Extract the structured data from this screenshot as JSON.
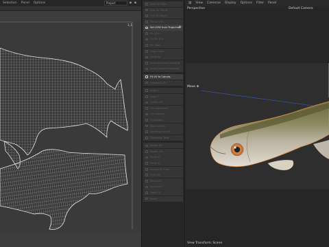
{
  "uv_editor": {
    "menu": [
      "Selection",
      "Panel",
      "Options"
    ],
    "dropdown_value": "Project",
    "corner_mark": "1,1"
  },
  "tools": [
    {
      "label": "Split UV Shell",
      "active": false
    },
    {
      "label": "Sew UV Shells",
      "active": false
    },
    {
      "label": "Cut UV Edges",
      "active": false
    },
    {
      "label": "Planar UVs",
      "active": false
    },
    {
      "label": "Set UVW from Projection",
      "active": true,
      "gear": true
    },
    {
      "label": "Pin UVs",
      "active": false
    },
    {
      "label": "Un-Pin UVs",
      "active": false
    },
    {
      "label": "Pin Shell",
      "active": false
    },
    {
      "label": "Unpin Shell",
      "active": false
    },
    {
      "label": "Un-Wrap",
      "active": false
    },
    {
      "label": "Scale Selected Mapping",
      "active": false
    },
    {
      "label": "Snap Selected Mapping",
      "active": false
    },
    {
      "label": "Fit UV to Canvas",
      "active": true,
      "gap_before": true
    },
    {
      "label": "Unwrap to Fit",
      "active": false
    },
    {
      "label": "Align U",
      "active": false,
      "gap_before": true
    },
    {
      "label": "Align V",
      "active": false
    },
    {
      "label": "Center UV",
      "active": false
    },
    {
      "label": "Flip Horizontal",
      "active": false
    },
    {
      "label": "Flip Vertical",
      "active": false
    },
    {
      "label": "Straighten",
      "active": false
    },
    {
      "label": "Stack Shells",
      "active": false
    },
    {
      "label": "Distribute Shells",
      "active": false
    },
    {
      "label": "Normalize Texel",
      "active": false
    },
    {
      "label": "Rotate 90",
      "active": false,
      "gap_before": true
    },
    {
      "label": "Rotate -90",
      "active": false
    },
    {
      "label": "Mirror U",
      "active": false
    },
    {
      "label": "Mirror V",
      "active": false
    },
    {
      "label": "Layout UV Tiles",
      "active": false
    },
    {
      "label": "Pack UV",
      "active": false
    },
    {
      "label": "Relax UV",
      "active": false
    },
    {
      "label": "Shell Info",
      "active": false
    },
    {
      "label": "Texel UV",
      "active": false
    },
    {
      "label": "Reset",
      "active": false
    }
  ],
  "viewport": {
    "menu": [
      "View",
      "Cameras",
      "Display",
      "Options",
      "Filter",
      "Panel"
    ],
    "projection": "Perspective",
    "camera": "Default Camera",
    "tool_label": "Move",
    "status": "View Transform: Scene"
  },
  "colors": {
    "uv_wire": "#e6e6e6",
    "accent_active": "#e4e4e4",
    "fish_body": "#8a8a6a"
  }
}
